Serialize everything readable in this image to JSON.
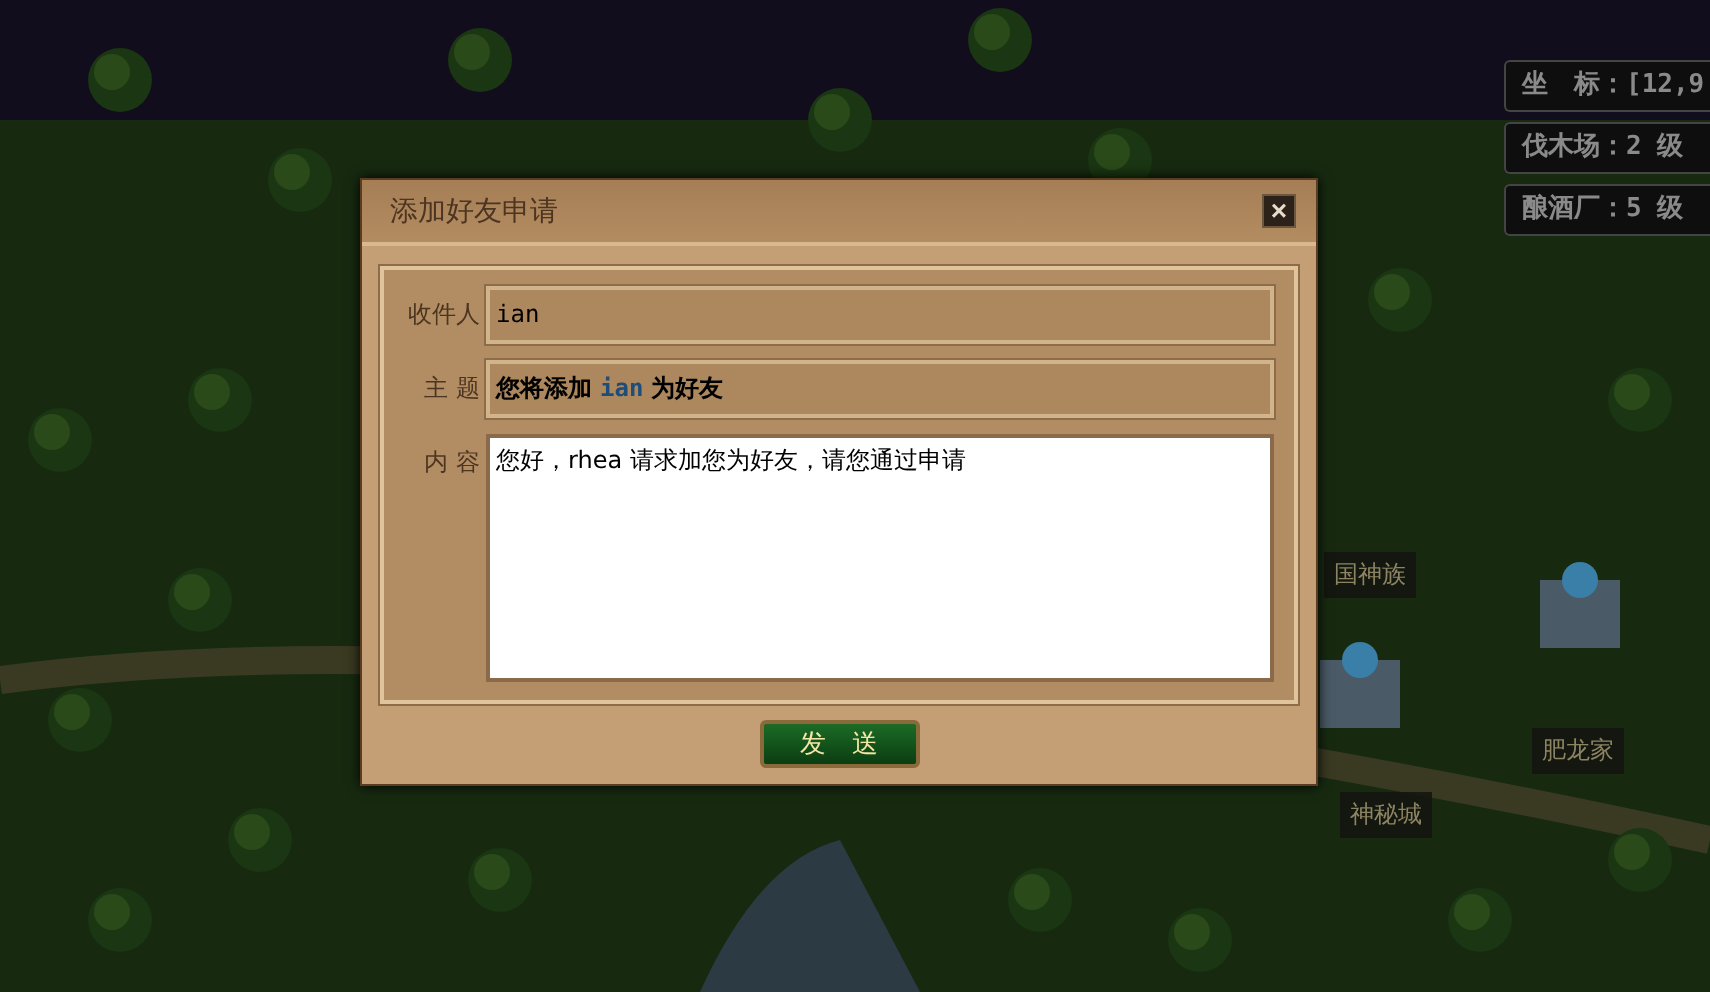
{
  "info_panel": {
    "rows": [
      {
        "text": "坐　标：[12,9"
      },
      {
        "text": "伐木场：2 级"
      },
      {
        "text": "酿酒厂：5 级"
      }
    ]
  },
  "map_labels": [
    {
      "text": "国神族"
    },
    {
      "text": "神秘城"
    },
    {
      "text": "肥龙家"
    }
  ],
  "dialog": {
    "title": "添加好友申请",
    "close": "×",
    "fields": [
      {
        "kind": "input",
        "label": "收件人",
        "value": "ian"
      },
      {
        "kind": "subject",
        "label": "主 题",
        "segments": [
          {
            "kind": "plain",
            "text": "您将添加"
          },
          {
            "kind": "highlight",
            "text": "ian"
          },
          {
            "kind": "plain",
            "text": "为好友"
          }
        ]
      },
      {
        "kind": "textarea",
        "label": "内 容",
        "value": "您好，rhea 请求加您为好友，请您通过申请"
      }
    ],
    "send_button": "发　送"
  }
}
